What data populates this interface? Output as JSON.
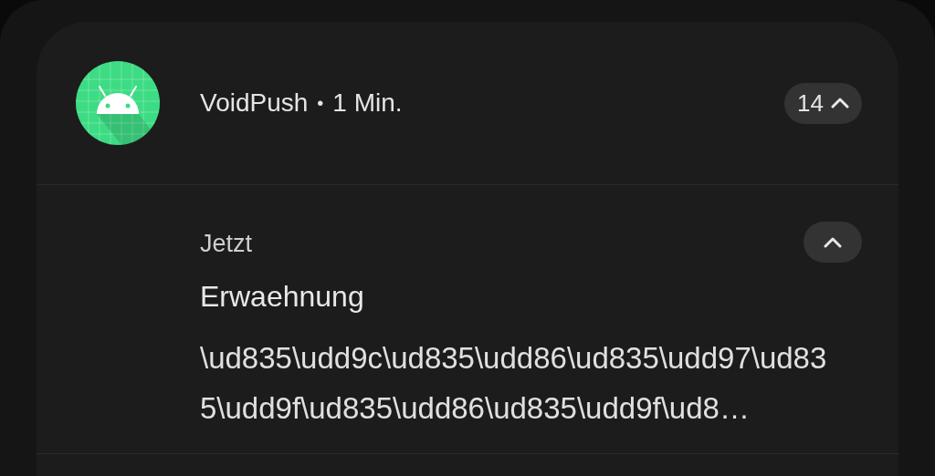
{
  "group": {
    "app_name": "VoidPush",
    "separator": "•",
    "time": "1 Min.",
    "count": "14",
    "expanded": true
  },
  "notifications": [
    {
      "time": "Jetzt",
      "title": "Erwaehnung",
      "body": "\\ud835\\udd9c\\ud835\\udd86\\ud835\\udd97\\ud835\\udd9f\\ud835\\udd86\\ud835\\udd9f\\ud8…",
      "expanded": true
    }
  ]
}
